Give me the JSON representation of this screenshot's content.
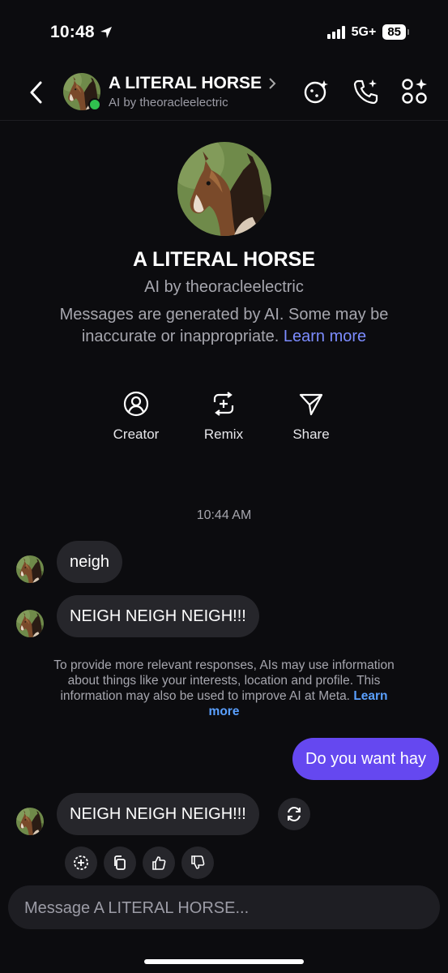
{
  "status": {
    "time": "10:48",
    "network": "5G+",
    "battery": "85"
  },
  "header": {
    "title": "A LITERAL HORSE",
    "subtitle": "AI by theoracleelectric"
  },
  "profile": {
    "name": "A LITERAL HORSE",
    "subtitle": "AI by theoracleelectric",
    "disclaimer": "Messages are generated by AI. Some may be inaccurate or inappropriate.",
    "learn_more": "Learn more"
  },
  "actions": [
    {
      "label": "Creator",
      "icon": "person-circle-icon"
    },
    {
      "label": "Remix",
      "icon": "remix-icon"
    },
    {
      "label": "Share",
      "icon": "send-icon"
    }
  ],
  "chat": {
    "timestamp": "10:44 AM",
    "messages": [
      {
        "from": "user-ai",
        "text": "neigh"
      },
      {
        "from": "ai",
        "text": "NEIGH NEIGH NEIGH!!!"
      },
      {
        "from": "me",
        "text": "Do you want hay"
      },
      {
        "from": "ai",
        "text": "NEIGH NEIGH NEIGH!!!"
      }
    ],
    "privacy_notice": "To provide more relevant responses, AIs may use information about things like your interests, location and profile. This information may also be used to improve AI at Meta.",
    "privacy_link": "Learn more"
  },
  "composer": {
    "placeholder": "Message A LITERAL HORSE..."
  },
  "colors": {
    "background": "#0c0c0f",
    "bubble_incoming": "#26262b",
    "bubble_outgoing": "#6548f0",
    "link": "#7c8cff",
    "online": "#30c04f"
  }
}
